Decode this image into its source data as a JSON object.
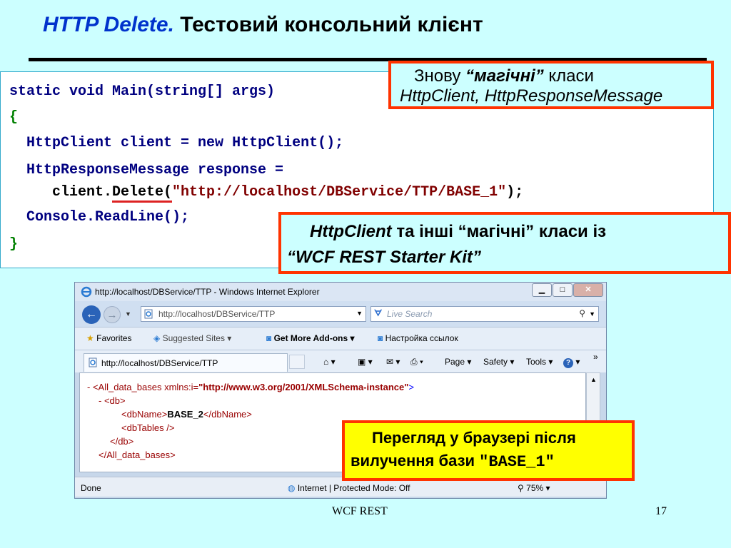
{
  "slide": {
    "title_italic": "HTTP Delete.",
    "title_rest": "Тестовий консольний клієнт",
    "footer": "WCF REST",
    "page_number": "17"
  },
  "code": {
    "line1": "static void Main(string[] args)",
    "line2": "{",
    "line3_a": "  HttpClient client = ",
    "line3_new": "new",
    "line3_b": " HttpClient();",
    "line4": "  HttpResponseMessage response =",
    "line5_indent": "     ",
    "line5_client": "client.",
    "line5_delete": "Delete(",
    "line5_string": "\"http://localhost/DBService/TTP/BASE_1\"",
    "line5_end": ");",
    "line6": "  Console.ReadLine();",
    "line7": "}"
  },
  "callouts": {
    "magic_line1_a": "Знову ",
    "magic_line1_b": "“магічні”",
    "magic_line1_c": " класи",
    "magic_line2": "HttpClient, HttpResponseMessage",
    "starter_line1_a": "HttpClient",
    "starter_line1_b": "  та інші “магічні” класи із",
    "starter_line2": "“WCF REST Starter Kit”",
    "browser_line1": "Перегляд у браузері після",
    "browser_line2_a": "вилучення бази ",
    "browser_line2_b": "\"BASE_1\""
  },
  "browser": {
    "window_title": "http://localhost/DBService/TTP - Windows Internet Explorer",
    "address": "http://localhost/DBService/TTP",
    "search_placeholder": "Live Search",
    "favorites": "Favorites",
    "suggested_sites": "Suggested Sites ▾",
    "get_more_addons": "Get More Add-ons ▾",
    "nastroyka": "Настройка ссылок",
    "tab_title": "http://localhost/DBService/TTP",
    "page_menu": "Page ▾",
    "safety_menu": "Safety ▾",
    "tools_menu": "Tools ▾",
    "status_done": "Done",
    "status_zone": "Internet | Protected Mode: Off",
    "zoom": "75%",
    "xml": {
      "l1_minus": "- ",
      "l1_tag_open": "<All_data_bases ",
      "l1_attr": "xmlns:i=",
      "l1_val": "\"http://www.w3.org/2001/XMLSchema-instance\"",
      "l1_close": ">",
      "l2": "- <db>",
      "l3_open": "<dbName>",
      "l3_value": "BASE_2",
      "l3_close": "</dbName>",
      "l4": "<dbTables />",
      "l5": "</db>",
      "l6": "</All_data_bases>"
    }
  }
}
